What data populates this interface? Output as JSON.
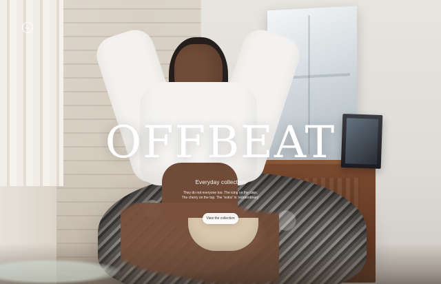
{
  "hero": {
    "headline": "OFFBEAT",
    "subtitle": "Everyday collection",
    "description_line1": "They do not everyone too. The icing on the cake,",
    "description_line2": "The cherry on the top. The “extra” in ‘extraordinary’",
    "cta_label": "View the collection"
  },
  "ui": {
    "menu_icon": "menu-icon"
  },
  "colors": {
    "overlay_text": "#ffffff",
    "button_bg": "#ffffff",
    "button_text": "#3a2f2a"
  }
}
